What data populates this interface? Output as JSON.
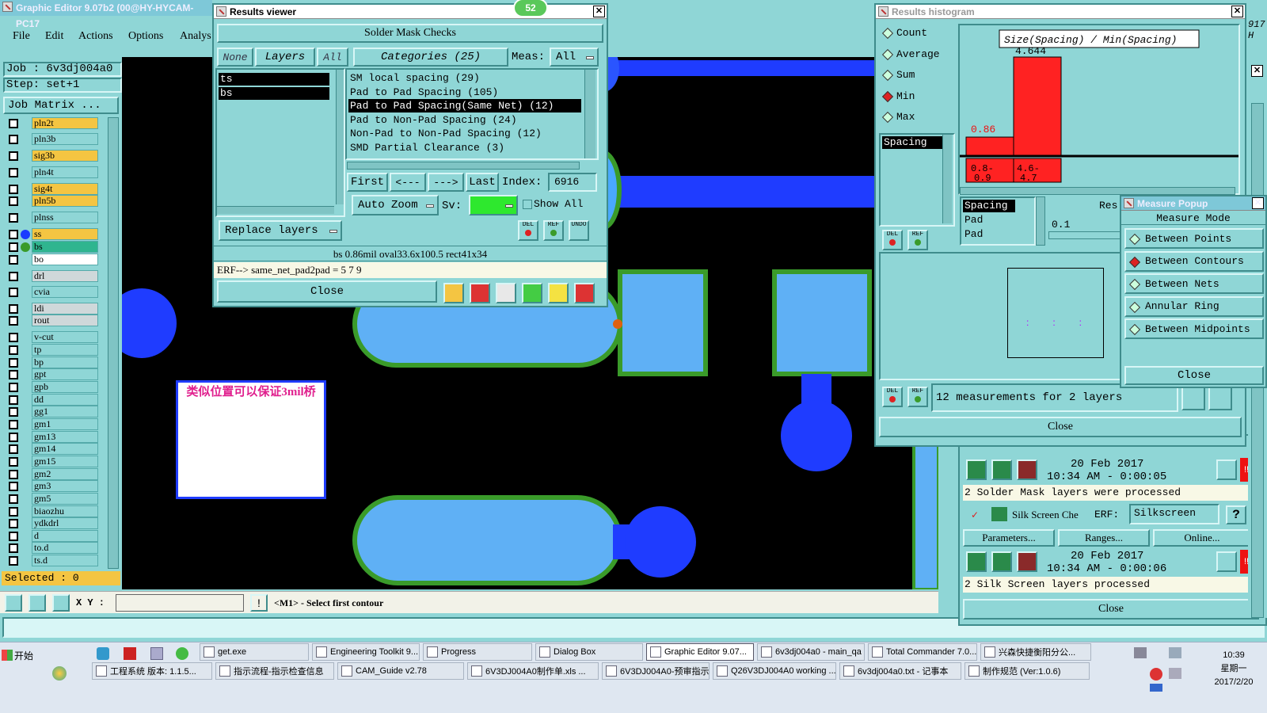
{
  "main_window": {
    "title": "Graphic Editor 9.07b2 (00@HY-HYCAM-PC17",
    "menu": [
      "File",
      "Edit",
      "Actions",
      "Options",
      "Analys"
    ],
    "job_label": "Job : 6v3dj004a0",
    "step_label": "Step: set+1",
    "job_matrix": "Job Matrix ...",
    "layers": [
      {
        "name": "pln2t",
        "color": "ylw"
      },
      {
        "name": "pln3b",
        "color": "teal"
      },
      {
        "name": "sig3b",
        "color": "ylw"
      },
      {
        "name": "pln4t",
        "color": "teal"
      },
      {
        "name": "sig4t",
        "color": "ylw"
      },
      {
        "name": "pln5b",
        "color": "ylw"
      },
      {
        "name": "plnss",
        "color": "teal"
      },
      {
        "name": "ss",
        "color": "ylw",
        "dot": "#1a3cff"
      },
      {
        "name": "bs",
        "color": "grn",
        "dot": "#3a9b2a"
      },
      {
        "name": "bo",
        "color": "wht"
      },
      {
        "name": "drl",
        "color": "gry"
      },
      {
        "name": "cvia",
        "color": "teal"
      },
      {
        "name": "ldi",
        "color": "gry"
      },
      {
        "name": "rout",
        "color": "gry"
      },
      {
        "name": "v-cut",
        "color": "teal"
      },
      {
        "name": "tp",
        "color": "teal"
      },
      {
        "name": "bp",
        "color": "teal"
      },
      {
        "name": "gpt",
        "color": "teal"
      },
      {
        "name": "gpb",
        "color": "teal"
      },
      {
        "name": "dd",
        "color": "teal"
      },
      {
        "name": "gg1",
        "color": "teal"
      },
      {
        "name": "gm1",
        "color": "teal"
      },
      {
        "name": "gm13",
        "color": "teal"
      },
      {
        "name": "gm14",
        "color": "teal"
      },
      {
        "name": "gm15",
        "color": "teal"
      },
      {
        "name": "gm2",
        "color": "teal"
      },
      {
        "name": "gm3",
        "color": "teal"
      },
      {
        "name": "gm5",
        "color": "teal"
      },
      {
        "name": "biaozhu",
        "color": "teal"
      },
      {
        "name": "ydkdrl",
        "color": "teal"
      },
      {
        "name": "d",
        "color": "teal"
      },
      {
        "name": "to.d",
        "color": "teal"
      },
      {
        "name": "ts.d",
        "color": "teal"
      }
    ],
    "selected": "Selected : 0",
    "xy_label": "X Y :",
    "xy_value": "",
    "status_message": "<M1> - Select first contour",
    "annotation_text": "类似位置可以保证3mil桥"
  },
  "results_viewer": {
    "title": "Results viewer",
    "badge": "52",
    "header": "Solder Mask Checks",
    "none_btn": "None",
    "layers_btn": "Layers",
    "all_btn": "All",
    "categories_btn": "Categories (25)",
    "meas_label": "Meas:",
    "meas_value": "All",
    "layer_items": [
      "ts",
      "bs"
    ],
    "categories": [
      "SM local spacing (29)",
      "Pad to Pad Spacing (105)",
      "Pad to Pad Spacing(Same Net) (12)",
      "Pad to Non-Pad Spacing (24)",
      "Non-Pad to Non-Pad Spacing (12)",
      "SMD Partial Clearance (3)"
    ],
    "selected_category_index": 2,
    "first": "First",
    "prev": "<---",
    "next": "--->",
    "last": "Last",
    "index_label": "Index:",
    "index_value": "6916",
    "auto_zoom": "Auto Zoom",
    "sv_label": "Sv:",
    "show_all": "Show All",
    "replace_layers": "Replace layers",
    "del": "DEL",
    "ref": "REF",
    "undo": "UNDO",
    "info_line": "bs 0.86mil   oval33.6x100.5   rect41x34",
    "erf_line": "ERF--> same_net_pad2pad = 5 7 9",
    "close": "Close"
  },
  "histogram": {
    "title": "Results histogram",
    "options": [
      "Count",
      "Average",
      "Sum",
      "Min",
      "Max"
    ],
    "selected_option": "Min",
    "list_item": "Spacing",
    "chart_title": "Size(Spacing) / Min(Spacing)",
    "top_value": "4.644",
    "low_value": "0.86",
    "bin1_label_a": "0.8-",
    "bin1_label_b": "0.9",
    "bin2_label_a": "4.6-",
    "bin2_label_b": "4.7",
    "res_items": [
      "Spacing",
      "Pad",
      "Pad"
    ],
    "res_label": "Res",
    "res_value": "0.1",
    "measurements": "12 measurements for 2 layers",
    "del": "DEL",
    "ref": "REF",
    "close": "Close"
  },
  "measure_popup": {
    "title": "Measure Popup",
    "mode_label": "Measure Mode",
    "modes": [
      "Between Points",
      "Between Contours",
      "Between Nets",
      "Annular Ring",
      "Between Midpoints"
    ],
    "selected_mode": "Between Contours",
    "close": "Close"
  },
  "checklist_panel": {
    "date1": "20 Feb 2017",
    "time1": "10:34 AM - 0:00:05",
    "msg1": "2 Solder Mask layers were processed",
    "silk_label": "Silk Screen Che",
    "erf_label": "ERF:",
    "erf_value": "Silkscreen",
    "help": "?",
    "params": "Parameters...",
    "ranges": "Ranges...",
    "online": "Online...",
    "date2": "20 Feb 2017",
    "time2": "10:34 AM - 0:00:06",
    "msg2": "2 Silk Screen layers processed",
    "close": "Close"
  },
  "right_edge": {
    "line1": "917",
    "line2": "H"
  },
  "taskbar": {
    "start": "开始",
    "row1": [
      "get.exe",
      "Engineering Toolkit 9....",
      "Progress",
      "Dialog Box",
      "Graphic Editor 9.07...",
      "6v3dj004a0 - main_qa",
      "Total Commander 7.0...",
      "兴森快捷衡阳分公..."
    ],
    "active_index": 4,
    "row2": [
      "工程系统  版本: 1.1.5...",
      "指示流程-指示检查信息",
      "CAM_Guide v2.78",
      "6V3DJ004A0制作单.xls ...",
      "6V3DJ004A0-预审指示....",
      "Q26V3DJ004A0 working ...",
      "6v3dj004a0.txt - 记事本",
      "制作规范 (Ver:1.0.6)"
    ],
    "clock_time": "10:39",
    "clock_day": "星期一",
    "clock_date": "2017/2/20"
  }
}
